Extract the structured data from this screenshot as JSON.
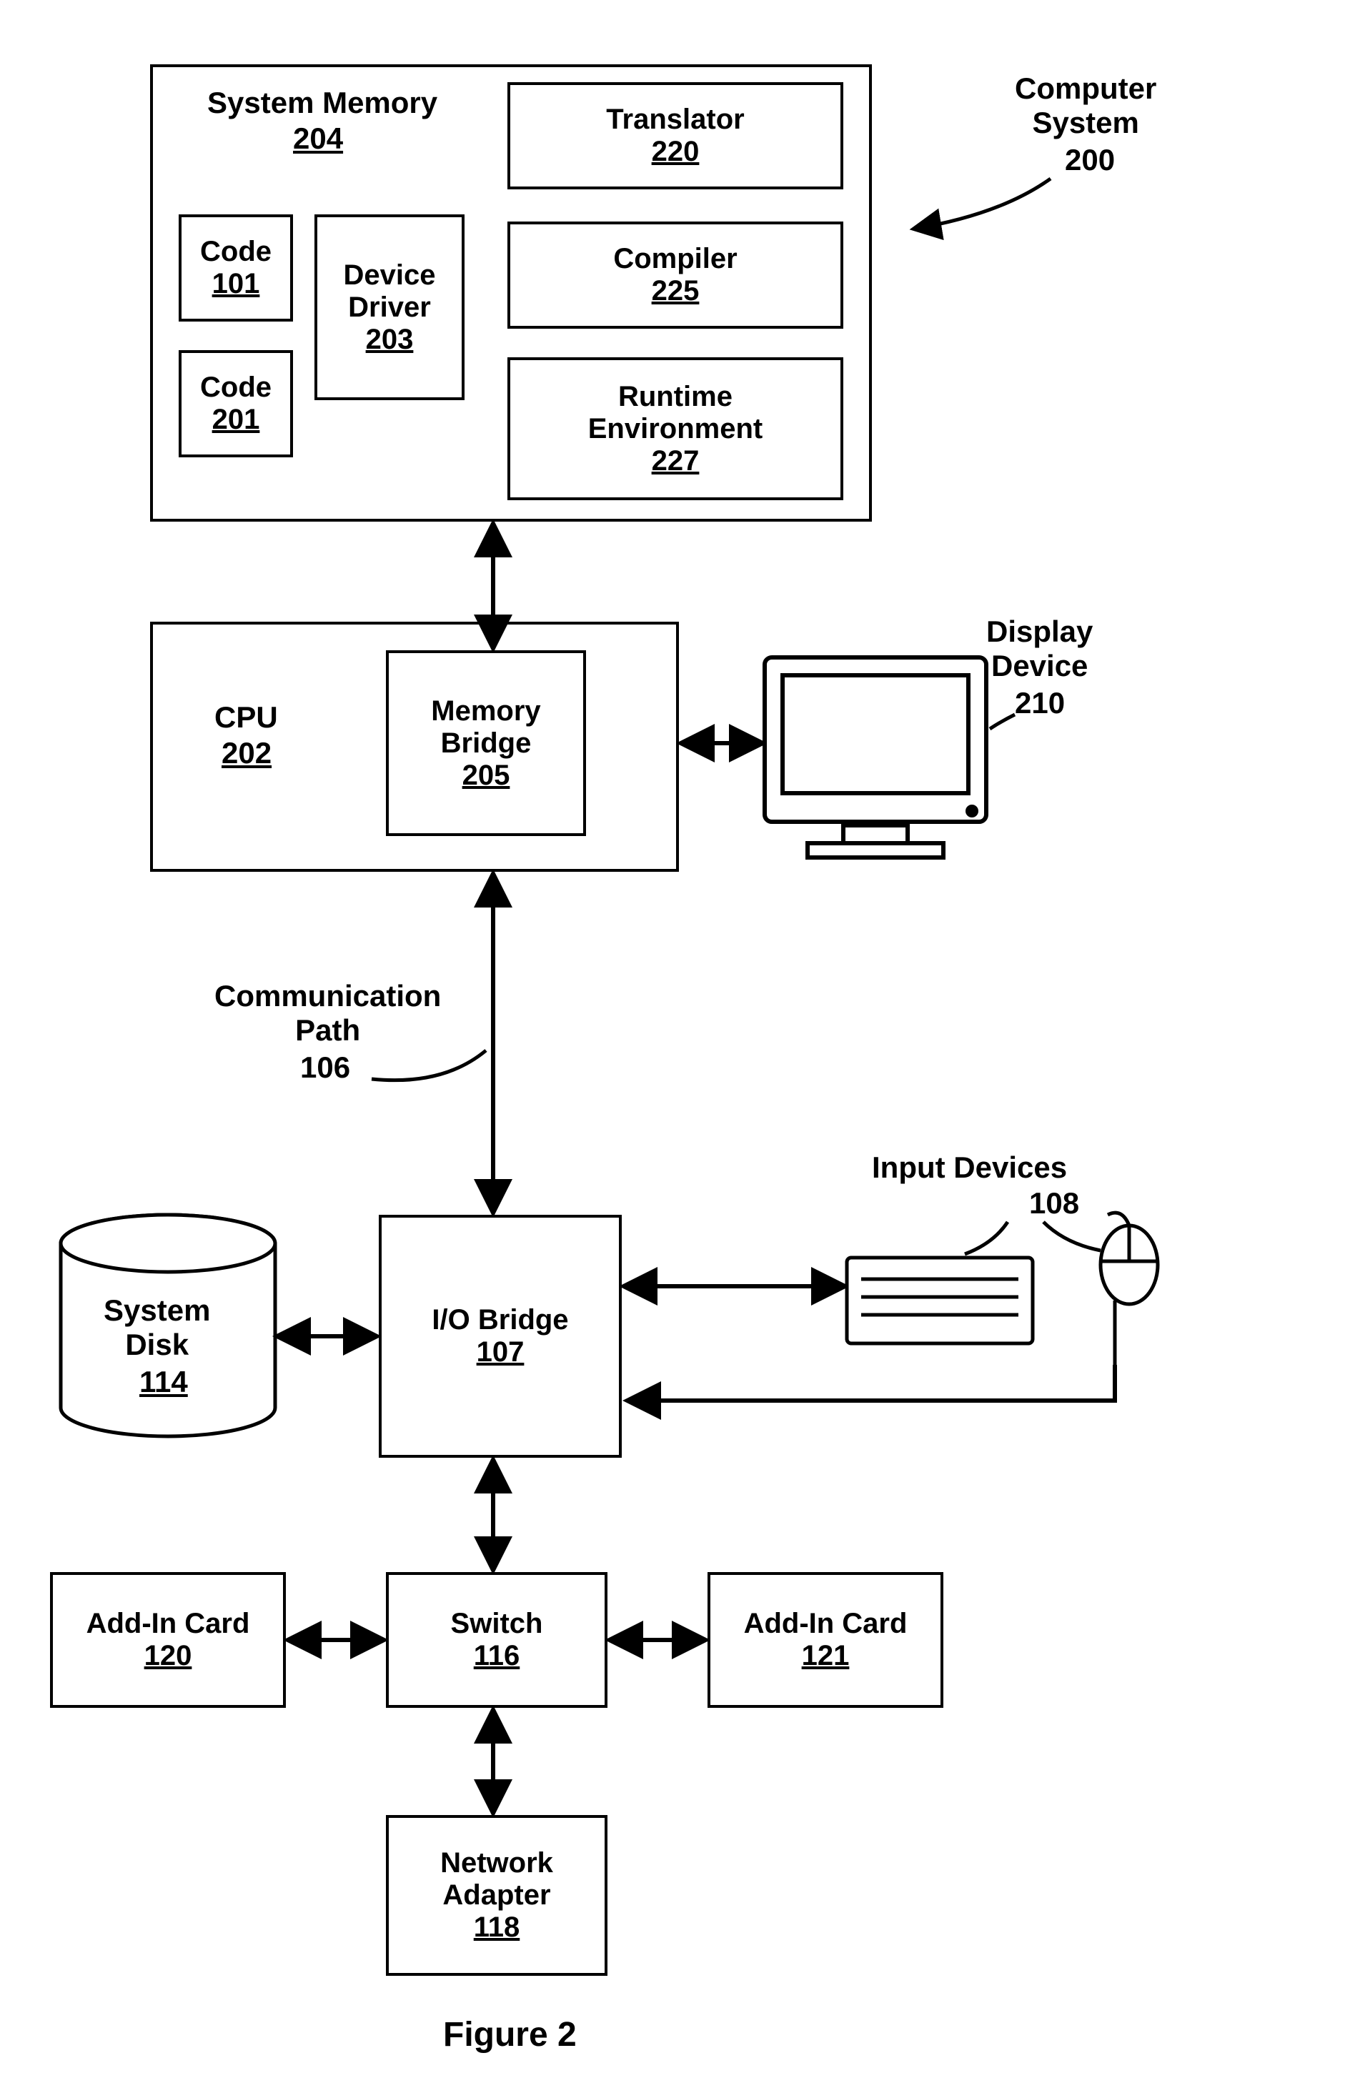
{
  "figure_caption": "Figure 2",
  "computer_system": {
    "label": "Computer\nSystem",
    "num": "200"
  },
  "system_memory": {
    "title": "System Memory",
    "num": "204",
    "code101": {
      "label": "Code",
      "num": "101"
    },
    "code201": {
      "label": "Code",
      "num": "201"
    },
    "device_driver": {
      "label": "Device\nDriver",
      "num": "203"
    },
    "translator": {
      "label": "Translator",
      "num": "220"
    },
    "compiler": {
      "label": "Compiler",
      "num": "225"
    },
    "runtime": {
      "label": "Runtime\nEnvironment",
      "num": "227"
    }
  },
  "cpu": {
    "label": "CPU",
    "num": "202"
  },
  "memory_bridge": {
    "label": "Memory\nBridge",
    "num": "205"
  },
  "display_device": {
    "label": "Display\nDevice",
    "num": "210"
  },
  "comm_path": {
    "label": "Communication\nPath",
    "num": "106"
  },
  "io_bridge": {
    "label": "I/O Bridge",
    "num": "107"
  },
  "system_disk": {
    "label": "System\nDisk",
    "num": "114"
  },
  "input_devices": {
    "label": "Input Devices",
    "num": "108"
  },
  "switch": {
    "label": "Switch",
    "num": "116"
  },
  "addin_left": {
    "label": "Add-In Card",
    "num": "120"
  },
  "addin_right": {
    "label": "Add-In Card",
    "num": "121"
  },
  "network_adapter": {
    "label": "Network\nAdapter",
    "num": "118"
  }
}
